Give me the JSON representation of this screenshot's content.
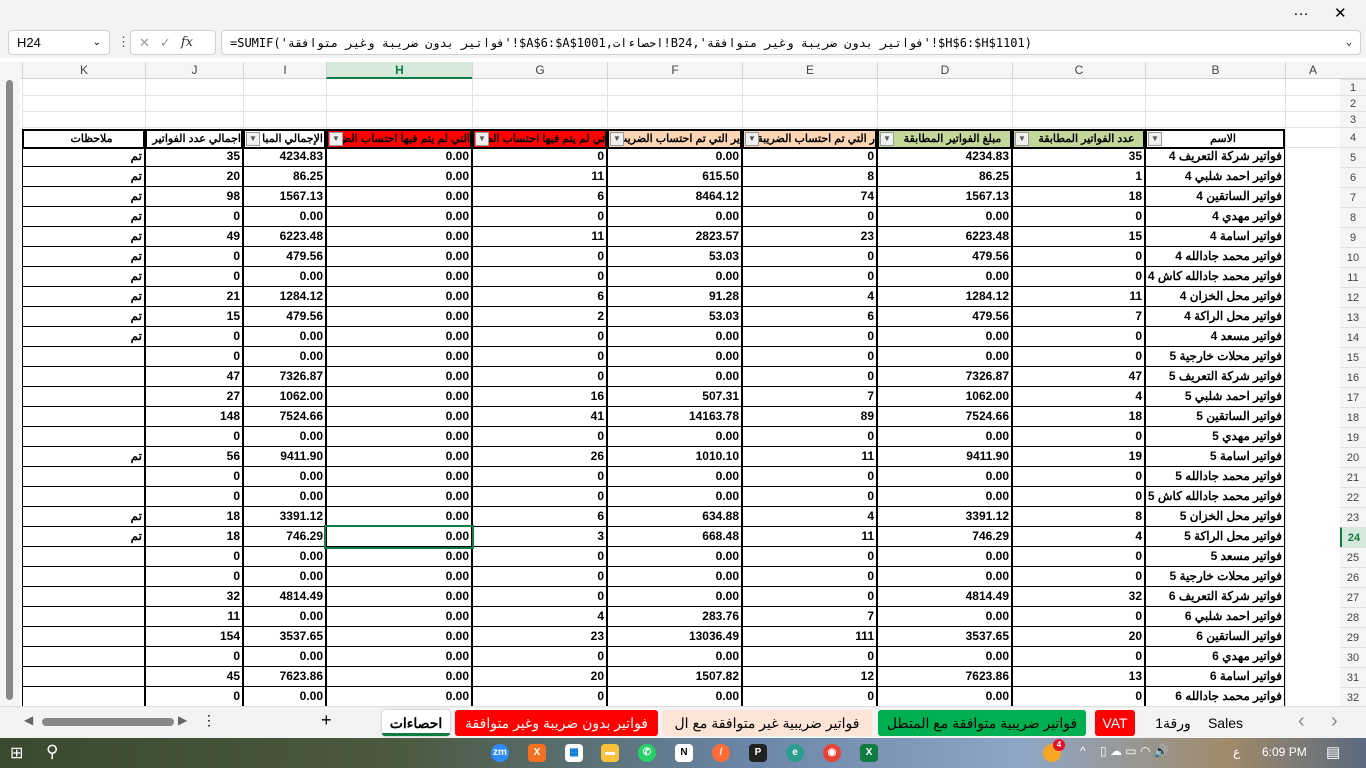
{
  "window": {
    "more_icon": "…",
    "close_icon": "✕"
  },
  "formula_bar": {
    "name_box": "H24",
    "formula": "=SUMIF('فواتير بدون ضريبة وغير متوافقة'!$A$6:$A$1001,احصاءات!B24,'فواتير بدون ضريبة وغير متوافقة'!$H$6:$H$1101)",
    "fx": "fx"
  },
  "columns": [
    "A",
    "B",
    "C",
    "D",
    "E",
    "F",
    "G",
    "H",
    "I",
    "J",
    "K"
  ],
  "selected_cell": "H24",
  "headers": {
    "B": "الاسم",
    "C": "عدد الفواتير  المطابقة",
    "D": "مبلغ الفواتير المطابقة",
    "E": "ر التي تم احتساب الضريبة",
    "F": "ير التي تم احتساب الضريب",
    "G": "تي لم يتم فيها احتساب الض",
    "H": "التي لم يتم فيها احتساب الض",
    "I": "الإجمالي المبا",
    "J": "اجمالي عدد الفواتير",
    "K": "ملاحظات"
  },
  "header_colors": {
    "green": "#c4d79b",
    "peach": "#fcd5b4",
    "red": "#ff0000"
  },
  "rows": [
    [
      "فواتير شركة التعريف 4",
      "35",
      "4234.83",
      "0",
      "0.00",
      "0",
      "0.00",
      "4234.83",
      "35",
      "تم"
    ],
    [
      "فواتير احمد شلبي 4",
      "1",
      "86.25",
      "8",
      "615.50",
      "11",
      "0.00",
      "86.25",
      "20",
      "تم"
    ],
    [
      "فواتير الساتقين 4",
      "18",
      "1567.13",
      "74",
      "8464.12",
      "6",
      "0.00",
      "1567.13",
      "98",
      "تم"
    ],
    [
      "فواتير مهدي 4",
      "0",
      "0.00",
      "0",
      "0.00",
      "0",
      "0.00",
      "0.00",
      "0",
      "تم"
    ],
    [
      "فواتير اسامة 4",
      "15",
      "6223.48",
      "23",
      "2823.57",
      "11",
      "0.00",
      "6223.48",
      "49",
      "تم"
    ],
    [
      "فواتير محمد جادالله 4",
      "0",
      "479.56",
      "0",
      "53.03",
      "0",
      "0.00",
      "479.56",
      "0",
      "تم"
    ],
    [
      "فواتير محمد جادالله كاش 4",
      "0",
      "0.00",
      "0",
      "0.00",
      "0",
      "0.00",
      "0.00",
      "0",
      "تم"
    ],
    [
      "فواتير محل الخزان 4",
      "11",
      "1284.12",
      "4",
      "91.28",
      "6",
      "0.00",
      "1284.12",
      "21",
      "تم"
    ],
    [
      "فواتير محل الراكة 4",
      "7",
      "479.56",
      "6",
      "53.03",
      "2",
      "0.00",
      "479.56",
      "15",
      "تم"
    ],
    [
      "فواتير مسعد 4",
      "0",
      "0.00",
      "0",
      "0.00",
      "0",
      "0.00",
      "0.00",
      "0",
      "تم"
    ],
    [
      "فواتير محلات خارجية 5",
      "0",
      "0.00",
      "0",
      "0.00",
      "0",
      "0.00",
      "0.00",
      "0",
      ""
    ],
    [
      "فواتير شركة التعريف 5",
      "47",
      "7326.87",
      "0",
      "0.00",
      "0",
      "0.00",
      "7326.87",
      "47",
      ""
    ],
    [
      "فواتير احمد شلبي 5",
      "4",
      "1062.00",
      "7",
      "507.31",
      "16",
      "0.00",
      "1062.00",
      "27",
      ""
    ],
    [
      "فواتير الساتقين 5",
      "18",
      "7524.66",
      "89",
      "14163.78",
      "41",
      "0.00",
      "7524.66",
      "148",
      ""
    ],
    [
      "فواتير مهدي 5",
      "0",
      "0.00",
      "0",
      "0.00",
      "0",
      "0.00",
      "0.00",
      "0",
      ""
    ],
    [
      "فواتير اسامة 5",
      "19",
      "9411.90",
      "11",
      "1010.10",
      "26",
      "0.00",
      "9411.90",
      "56",
      "تم"
    ],
    [
      "فواتير محمد جادالله 5",
      "0",
      "0.00",
      "0",
      "0.00",
      "0",
      "0.00",
      "0.00",
      "0",
      ""
    ],
    [
      "فواتير محمد جادالله كاش 5",
      "0",
      "0.00",
      "0",
      "0.00",
      "0",
      "0.00",
      "0.00",
      "0",
      ""
    ],
    [
      "فواتير محل الخزان 5",
      "8",
      "3391.12",
      "4",
      "634.88",
      "6",
      "0.00",
      "3391.12",
      "18",
      "تم"
    ],
    [
      "فواتير محل الراكة 5",
      "4",
      "746.29",
      "11",
      "668.48",
      "3",
      "0.00",
      "746.29",
      "18",
      "تم"
    ],
    [
      "فواتير مسعد 5",
      "0",
      "0.00",
      "0",
      "0.00",
      "0",
      "0.00",
      "0.00",
      "0",
      ""
    ],
    [
      "فواتير محلات خارجية 5",
      "0",
      "0.00",
      "0",
      "0.00",
      "0",
      "0.00",
      "0.00",
      "0",
      ""
    ],
    [
      "فواتير شركة التعريف 6",
      "32",
      "4814.49",
      "0",
      "0.00",
      "0",
      "0.00",
      "4814.49",
      "32",
      ""
    ],
    [
      "فواتير احمد شلبي 6",
      "0",
      "0.00",
      "7",
      "283.76",
      "4",
      "0.00",
      "0.00",
      "11",
      ""
    ],
    [
      "فواتير الساتقين 6",
      "20",
      "3537.65",
      "111",
      "13036.49",
      "23",
      "0.00",
      "3537.65",
      "154",
      ""
    ],
    [
      "فواتير مهدي 6",
      "0",
      "0.00",
      "0",
      "0.00",
      "0",
      "0.00",
      "0.00",
      "0",
      ""
    ],
    [
      "فواتير اسامة 6",
      "13",
      "7623.86",
      "12",
      "1507.82",
      "20",
      "0.00",
      "7623.86",
      "45",
      ""
    ],
    [
      "فواتير محمد جادالله 6",
      "0",
      "0.00",
      "0",
      "0.00",
      "0",
      "0.00",
      "0.00",
      "0",
      ""
    ]
  ],
  "row_numbers": [
    "1",
    "2",
    "3",
    "4",
    "5",
    "6",
    "7",
    "8",
    "9",
    "10",
    "11",
    "12",
    "13",
    "14",
    "15",
    "16",
    "17",
    "18",
    "19",
    "20",
    "21",
    "22",
    "23",
    "24",
    "25",
    "26",
    "27",
    "28",
    "29",
    "30",
    "31",
    "32"
  ],
  "sheet_tabs": [
    {
      "label": "احصاءات",
      "active": true,
      "bg": "#ffffff",
      "fg": "#000000"
    },
    {
      "label": "فواتير بدون ضريبة وغير متوافقة",
      "bg": "#ff0000",
      "fg": "#ffffff"
    },
    {
      "label": "فواتير ضريبية غير متوافقة مع ال",
      "bg": "#fce4d6",
      "fg": "#000000"
    },
    {
      "label": "فواتير ضريبية متوافقة مع المتطل",
      "bg": "#00b050",
      "fg": "#000000"
    },
    {
      "label": "VAT",
      "bg": "#ff0000",
      "fg": "#ffffff"
    },
    {
      "label": "ورقة1",
      "bg": "transparent",
      "fg": "#000000"
    },
    {
      "label": "Sales",
      "bg": "transparent",
      "fg": "#000000"
    }
  ],
  "tabbar": {
    "add": "+",
    "more": "⋮",
    "prev": "‹",
    "next": "›"
  },
  "taskbar": {
    "time": "6:09 PM",
    "lang": "ع",
    "badge": "4"
  }
}
